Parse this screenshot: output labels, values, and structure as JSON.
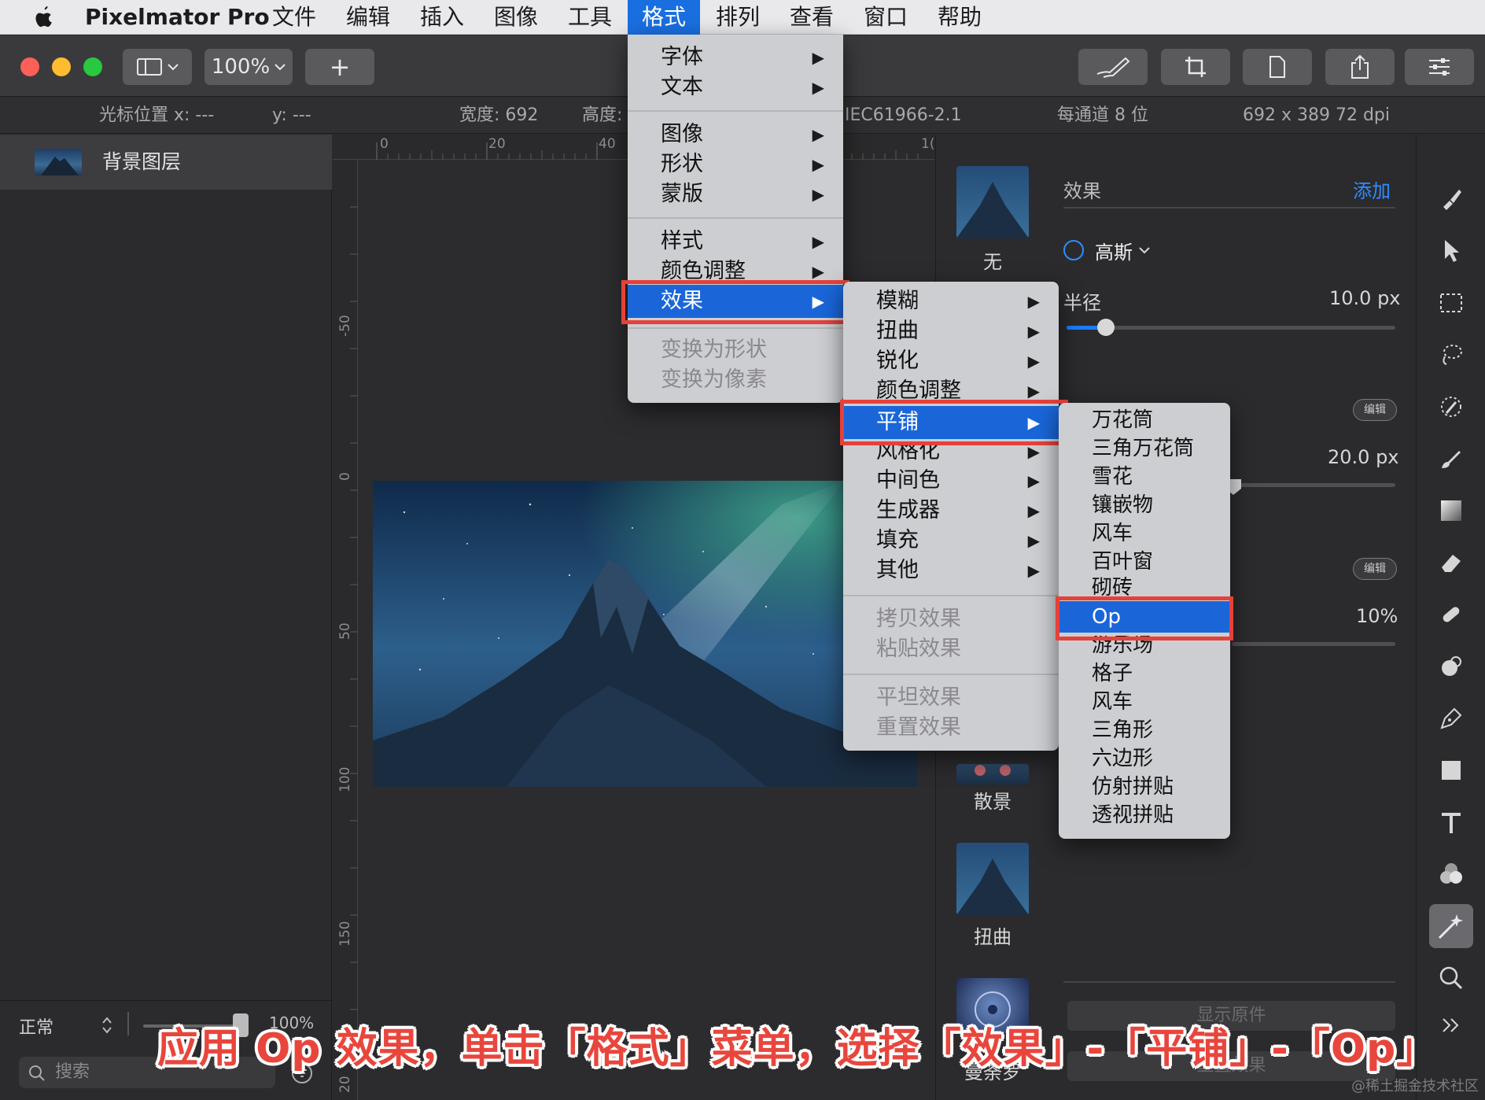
{
  "menubar": {
    "app_name": "Pixelmator Pro",
    "items": [
      "文件",
      "编辑",
      "插入",
      "图像",
      "工具",
      "格式",
      "排列",
      "查看",
      "窗口",
      "帮助"
    ]
  },
  "toolbar": {
    "zoom_label": "100%",
    "add_label": "+"
  },
  "infobar": {
    "cursor_x": "光标位置 x:  ---",
    "cursor_y": "y:  ---",
    "width": "宽度:  692",
    "height": "高度:",
    "color_profile": "IEC61966-2.1",
    "bit_depth": "每通道 8 位",
    "dimensions": "692 x 389 72 dpi"
  },
  "layers": {
    "layer_name": "背景图层",
    "blend_mode": "正常",
    "opacity": "100%",
    "search_placeholder": "搜索"
  },
  "rulers": {
    "h": [
      "0",
      "20",
      "40",
      "1("
    ],
    "v": [
      "-50",
      "0",
      "50",
      "100",
      "150",
      "20"
    ]
  },
  "right_panel": {
    "presets": [
      "无",
      "散景",
      "扭曲",
      "曼荼罗"
    ],
    "section_title": "效果",
    "add_label": "添加",
    "effect_name": "高斯",
    "radius_label": "半径",
    "radius_value": "10.0 px",
    "radius_fraction": 0.12,
    "value2": "20.0 px",
    "value3": "10%",
    "edit_badge": "编辑",
    "show_original": "显示原件",
    "reset": "重置效果"
  },
  "format_menu": {
    "items": [
      "字体",
      "文本",
      "图像",
      "形状",
      "蒙版",
      "样式",
      "颜色调整",
      "效果",
      "变换为形状",
      "变换为像素"
    ]
  },
  "effects_submenu": {
    "items": [
      "模糊",
      "扭曲",
      "锐化",
      "颜色调整",
      "平铺",
      "风格化",
      "中间色",
      "生成器",
      "填充",
      "其他",
      "拷贝效果",
      "粘贴效果",
      "平坦效果",
      "重置效果"
    ]
  },
  "tile_submenu": {
    "items": [
      "万花筒",
      "三角万花筒",
      "雪花",
      "镶嵌物",
      "风车",
      "百叶窗",
      "砌砖",
      "Op",
      "游乐场",
      "格子",
      "风车",
      "三角形",
      "六边形",
      "仿射拼贴",
      "透视拼贴"
    ]
  },
  "caption": "应用 Op 效果，单击「格式」菜单，选择「效果」-「平铺」-「Op」",
  "watermark": "@稀土掘金技术社区",
  "colors": {
    "accent": "#1a66d9",
    "highlight_box": "#e5413b",
    "menu_bg": "#cdced2"
  }
}
